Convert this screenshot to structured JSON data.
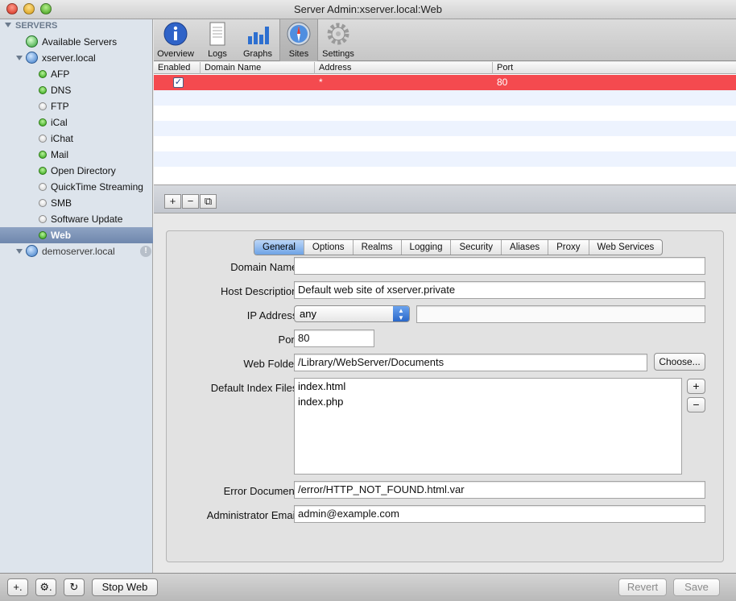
{
  "window": {
    "title": "Server Admin:xserver.local:Web"
  },
  "sidebar": {
    "header": "SERVERS",
    "available_servers": "Available Servers",
    "server": "xserver.local",
    "services": [
      {
        "label": "AFP",
        "status": "on"
      },
      {
        "label": "DNS",
        "status": "on"
      },
      {
        "label": "FTP",
        "status": "off"
      },
      {
        "label": "iCal",
        "status": "on"
      },
      {
        "label": "iChat",
        "status": "off"
      },
      {
        "label": "Mail",
        "status": "on"
      },
      {
        "label": "Open Directory",
        "status": "on"
      },
      {
        "label": "QuickTime Streaming",
        "status": "off"
      },
      {
        "label": "SMB",
        "status": "off"
      },
      {
        "label": "Software Update",
        "status": "off"
      },
      {
        "label": "Web",
        "status": "on"
      }
    ],
    "selected_service": "Web",
    "second_server": "demoserver.local"
  },
  "toolbar": {
    "buttons": [
      {
        "label": "Overview",
        "icon": "info-icon"
      },
      {
        "label": "Logs",
        "icon": "document-icon"
      },
      {
        "label": "Graphs",
        "icon": "bar-graph-icon"
      },
      {
        "label": "Sites",
        "icon": "compass-icon"
      },
      {
        "label": "Settings",
        "icon": "gear-icon"
      }
    ],
    "active": "Sites"
  },
  "sites_table": {
    "columns": [
      "Enabled",
      "Domain Name",
      "Address",
      "Port"
    ],
    "rows": [
      {
        "enabled": true,
        "domain": "",
        "address": "*",
        "port": "80"
      }
    ]
  },
  "table_buttons": {
    "add": "+",
    "remove": "−",
    "duplicate": "⧉"
  },
  "tabs": [
    "General",
    "Options",
    "Realms",
    "Logging",
    "Security",
    "Aliases",
    "Proxy",
    "Web Services"
  ],
  "active_tab": "General",
  "form": {
    "domain_name_label": "Domain Name:",
    "domain_name_value": "",
    "host_description_label": "Host Description:",
    "host_description_value": "Default web site of xserver.private",
    "ip_address_label": "IP Address:",
    "ip_address_value": "any",
    "ip_address_extra": "",
    "port_label": "Port:",
    "port_value": "80",
    "web_folder_label": "Web Folder:",
    "web_folder_value": "/Library/WebServer/Documents",
    "choose_button": "Choose...",
    "index_files_label": "Default Index Files:",
    "index_files": [
      "index.html",
      "index.php"
    ],
    "index_add": "+",
    "index_remove": "−",
    "error_document_label": "Error Document:",
    "error_document_value": "/error/HTTP_NOT_FOUND.html.var",
    "admin_email_label": "Administrator Email:",
    "admin_email_value": "admin@example.com"
  },
  "bottom_bar": {
    "add": "+.",
    "action": "⚙.",
    "refresh": "↻",
    "stop_web": "Stop Web",
    "revert": "Revert",
    "save": "Save"
  }
}
